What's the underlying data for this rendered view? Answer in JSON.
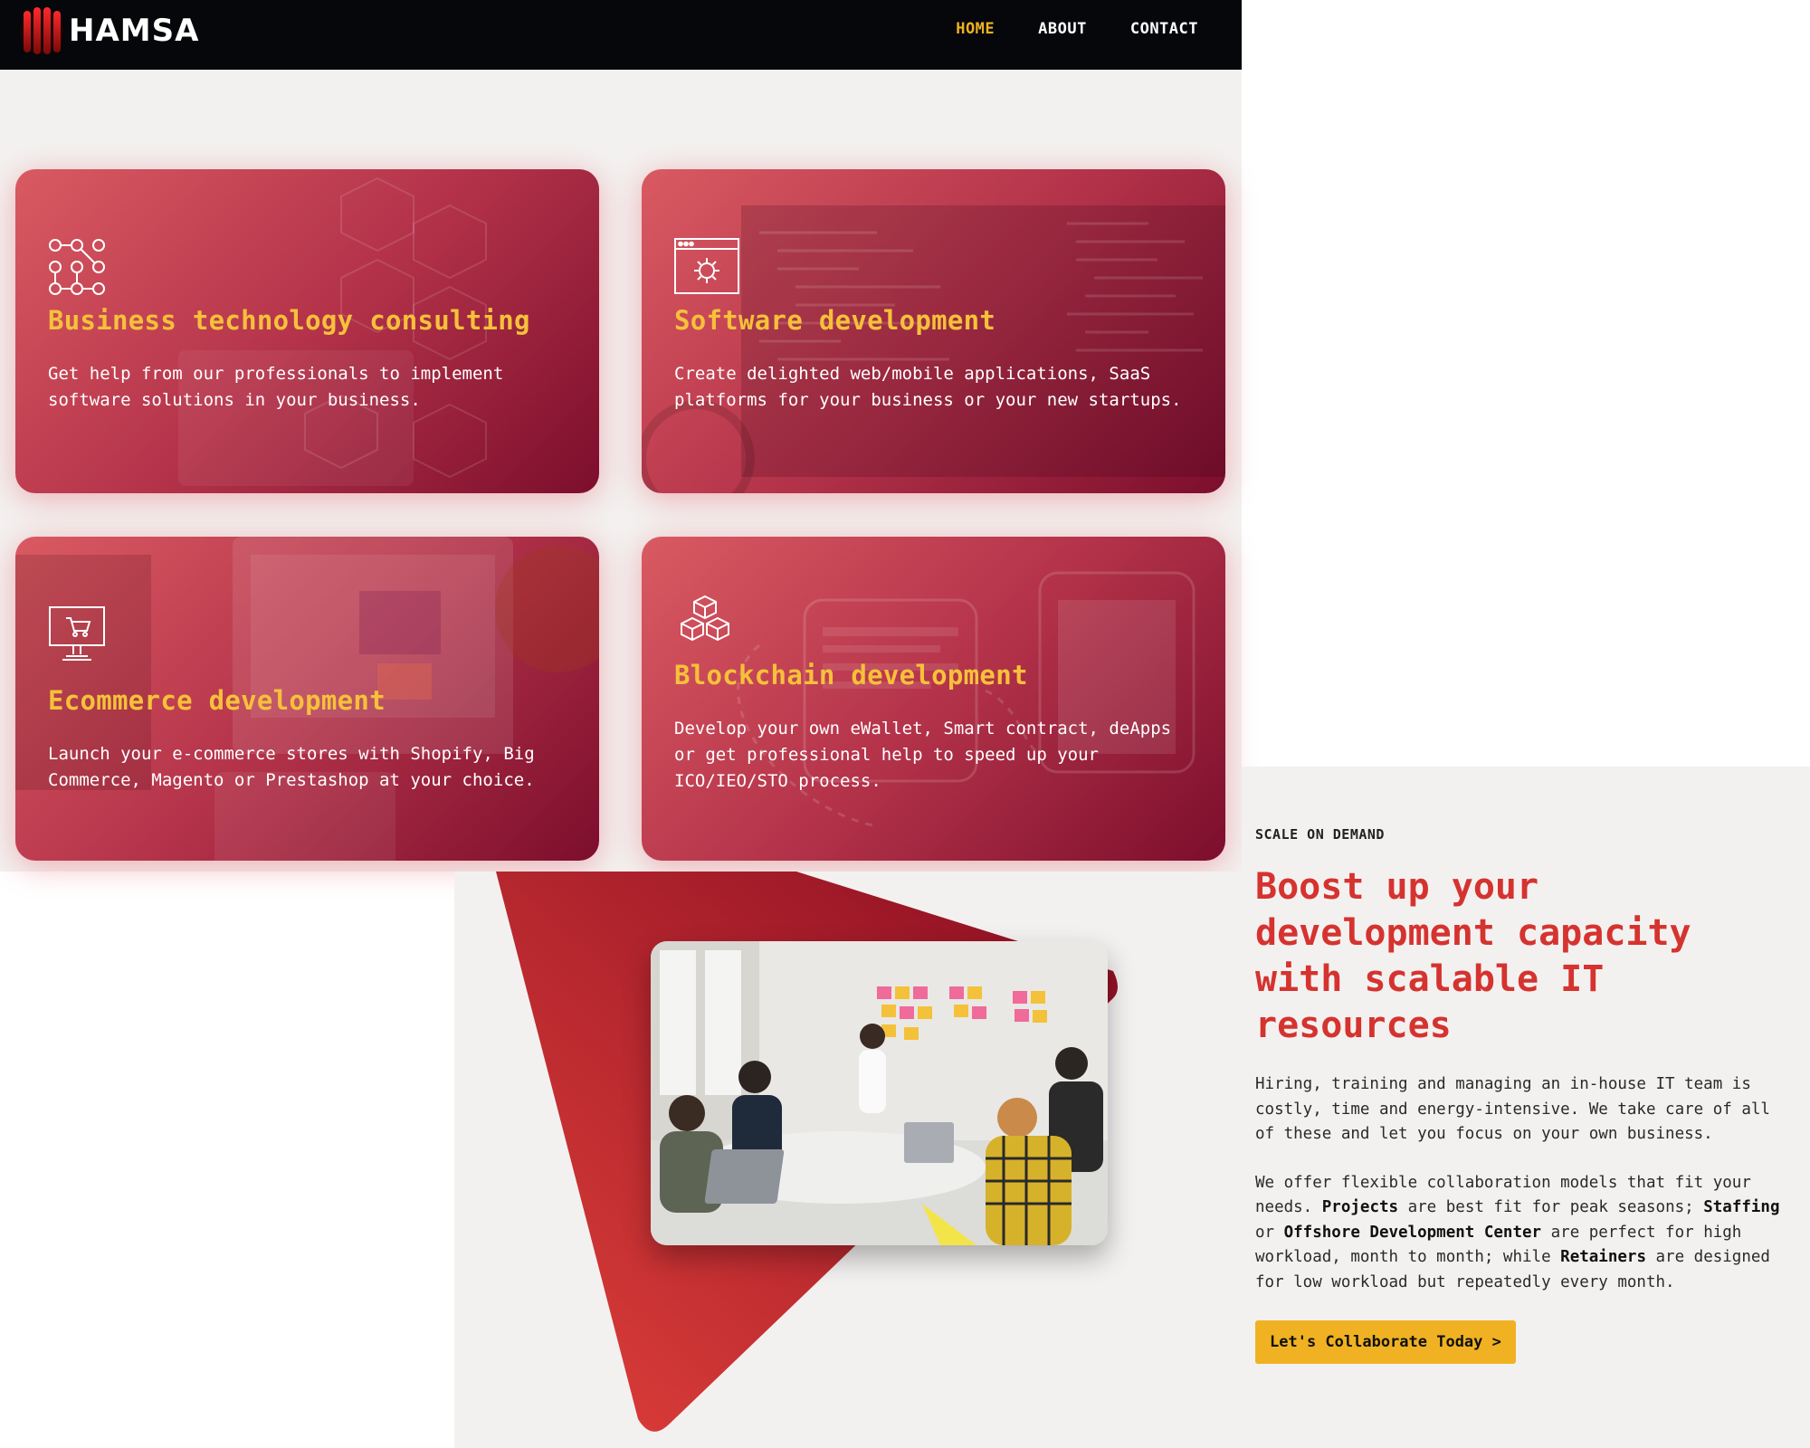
{
  "brand": {
    "name": "HAMSA",
    "accent": "#f0b222",
    "primary": "#d5332f"
  },
  "nav": {
    "items": [
      "HOME",
      "ABOUT",
      "CONTACT"
    ],
    "active": "HOME"
  },
  "services": [
    {
      "icon": "network-nodes-icon",
      "title": "Business technology consulting",
      "text": "Get help from our professionals to implement software solutions in your business."
    },
    {
      "icon": "browser-gear-icon",
      "title": "Software development",
      "text": "Create delighted web/mobile applications, SaaS platforms for your business or your new startups."
    },
    {
      "icon": "monitor-cart-icon",
      "title": "Ecommerce development",
      "text": "Launch your e-commerce stores with Shopify, Big Commerce, Magento or Prestashop at your choice."
    },
    {
      "icon": "cubes-icon",
      "title": "Blockchain development",
      "text": "Develop your own eWallet, Smart contract, deApps or get professional help to speed up your ICO/IEO/STO process."
    }
  ],
  "scale": {
    "eyebrow": "SCALE ON DEMAND",
    "headline": "Boost up your development capacity with scalable IT resources",
    "para1": "Hiring, training and managing an in-house IT team is costly, time and energy-intensive. We take care of all of these and let you focus on your own business.",
    "para2": {
      "t1": "We offer flexible collaboration models that fit your needs. ",
      "b1": "Projects",
      "t2": " are best fit for peak seasons; ",
      "b2": "Staffing",
      "t3": " or ",
      "b3": "Offshore Development Center",
      "t4": " are perfect for high workload, month to month; while ",
      "b4": "Retainers",
      "t5": " are designed for low workload but repeatedly every month."
    },
    "cta": "Let's Collaborate Today >"
  }
}
